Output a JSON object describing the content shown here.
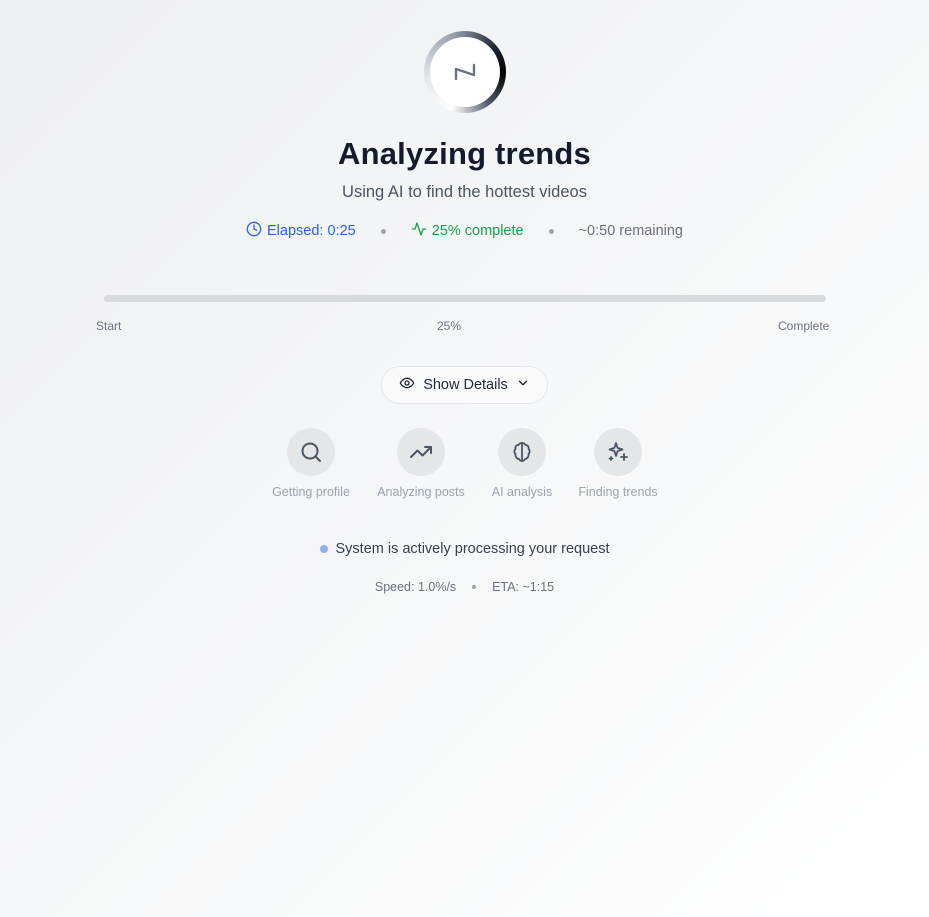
{
  "header": {
    "title": "Analyzing trends",
    "subtitle": "Using AI to find the hottest videos"
  },
  "stats": {
    "elapsed": "Elapsed: 0:25",
    "complete": "25% complete",
    "remaining": "~0:50 remaining"
  },
  "progress": {
    "value": 0.25,
    "start_label": "Start",
    "mid_label": "25%",
    "end_label": "Complete"
  },
  "details_button": {
    "label": "Show Details"
  },
  "steps": [
    {
      "label": "Getting profile",
      "icon": "search-icon"
    },
    {
      "label": "Analyzing posts",
      "icon": "trending-up-icon"
    },
    {
      "label": "AI analysis",
      "icon": "brain-icon"
    },
    {
      "label": "Finding trends",
      "icon": "sparkles-icon"
    }
  ],
  "status": {
    "text": "System is actively processing your request"
  },
  "meta": {
    "speed": "Speed: 1.0%/s",
    "eta": "ETA: ~1:15"
  },
  "colors": {
    "accent_blue": "#2563eb",
    "accent_green": "#16a34a",
    "pulse": "#93acef"
  }
}
